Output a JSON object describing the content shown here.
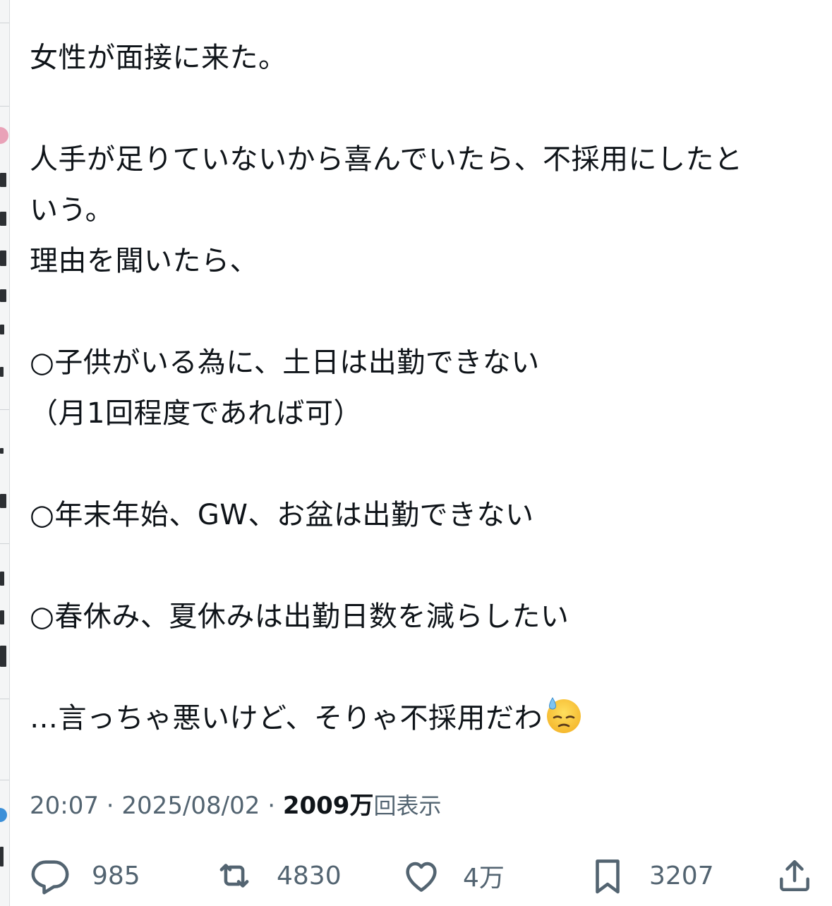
{
  "tweet": {
    "lines": [
      "女性が面接に来た。",
      "",
      "人手が足りていないから喜んでいたら、不採用にしたと",
      "いう。",
      "理由を聞いたら、",
      "",
      "○子供がいる為に、土日は出勤できない",
      "（月1回程度であれば可）",
      "",
      "○年末年始、GW、お盆は出勤できない",
      "",
      "○春休み、夏休みは出勤日数を減らしたい",
      "",
      "…言っちゃ悪いけど、そりゃ不採用だわ"
    ],
    "emoji": "downcast-face-with-sweat"
  },
  "meta": {
    "time": "20:07",
    "separator": "·",
    "date": "2025/08/02",
    "views_count": "2009万",
    "views_label": "回表示"
  },
  "actions": {
    "reply_count": "985",
    "retweet_count": "4830",
    "like_count": "4万",
    "bookmark_count": "3207"
  },
  "colors": {
    "text": "#0f1419",
    "secondary": "#536471",
    "background": "#ffffff"
  },
  "icons": [
    "reply-icon",
    "retweet-icon",
    "like-icon",
    "bookmark-icon",
    "share-icon"
  ]
}
